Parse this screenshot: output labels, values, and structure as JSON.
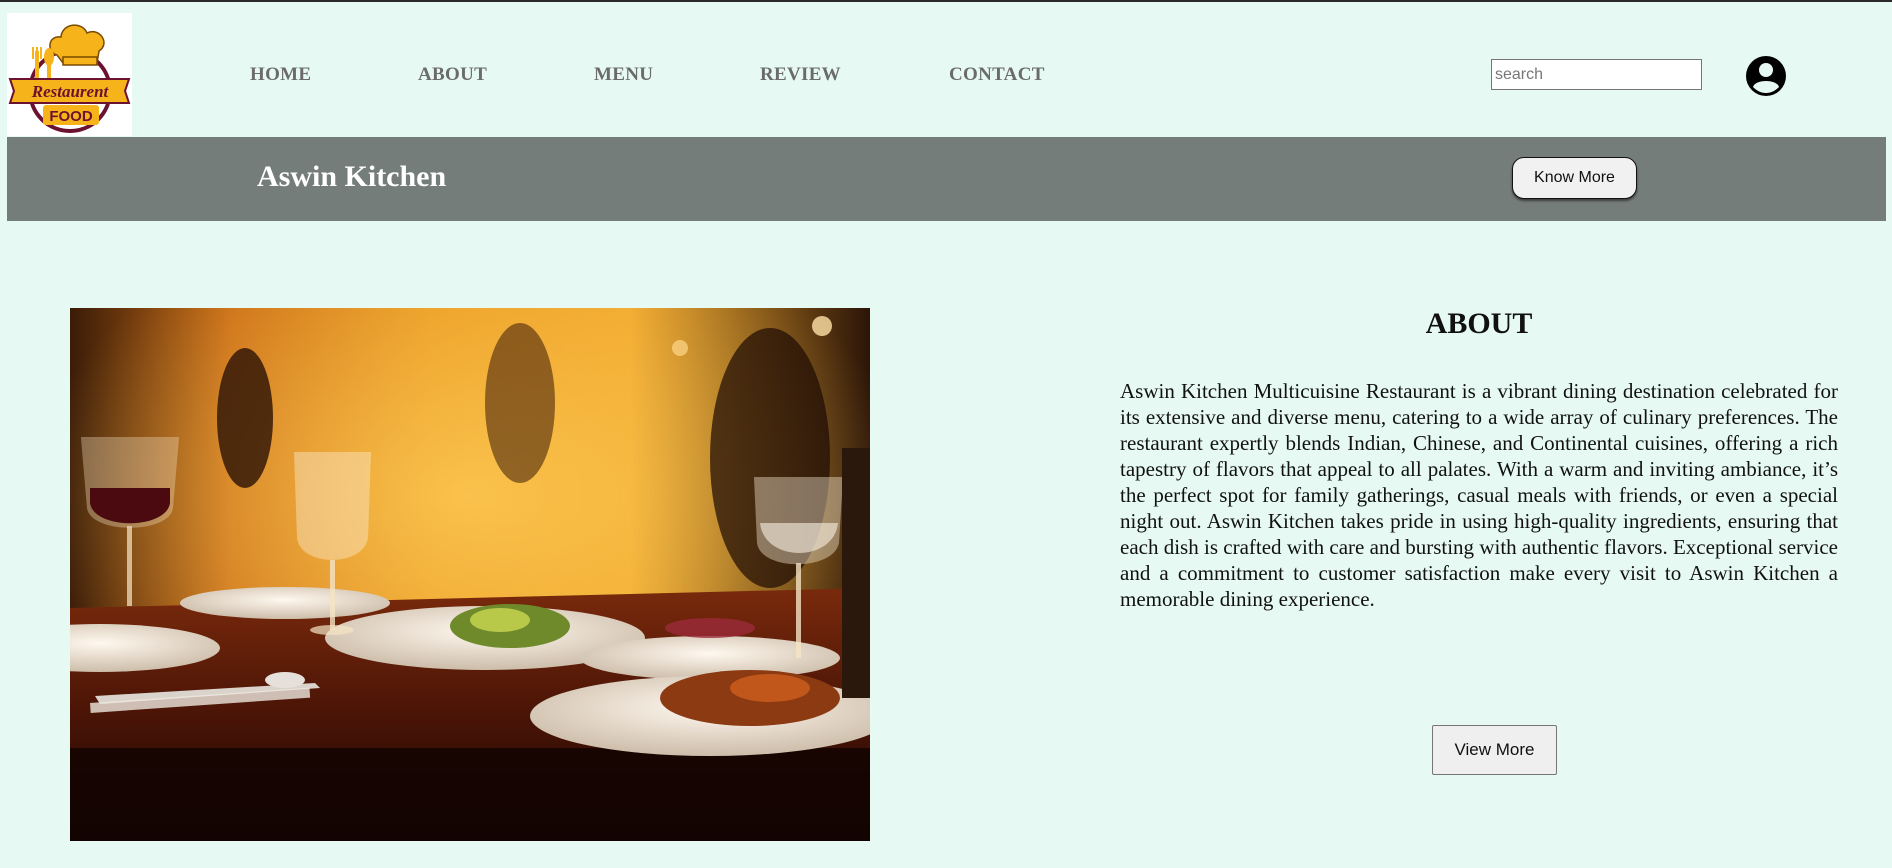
{
  "logo": {
    "text_top": "Restaurent",
    "text_bottom": "FOOD",
    "colors": {
      "yellow": "#f6b41a",
      "maroon": "#6b1230",
      "white": "#ffffff"
    }
  },
  "nav": {
    "items": [
      {
        "label": "HOME"
      },
      {
        "label": "ABOUT"
      },
      {
        "label": "MENU"
      },
      {
        "label": "REVIEW"
      },
      {
        "label": "CONTACT"
      }
    ],
    "search": {
      "placeholder": "search",
      "value": ""
    },
    "profile_icon": "user-circle-icon"
  },
  "banner": {
    "brand_name": "Aswin Kitchen",
    "button_label": "Know More",
    "background": "#757d7a"
  },
  "about": {
    "image_description": "restaurant-table-photo",
    "title": "ABOUT",
    "text": "Aswin Kitchen Multicuisine Restaurant is a vibrant dining destination celebrated for its extensive and diverse menu, catering to a wide array of culinary preferences. The restaurant expertly blends Indian, Chinese, and Continental cuisines, offering a rich tapestry of flavors that appeal to all palates. With a warm and inviting ambiance, it’s the perfect spot for family gatherings, casual meals with friends, or even a special night out. Aswin Kitchen takes pride in using high-quality ingredients, ensuring that each dish is crafted with care and bursting with authentic flavors. Exceptional service and a commitment to customer satisfaction make every visit to Aswin Kitchen a memorable dining experience.",
    "button_label": "View More"
  },
  "colors": {
    "page_background": "#e6f9f3",
    "nav_text": "#6b6b6b"
  }
}
